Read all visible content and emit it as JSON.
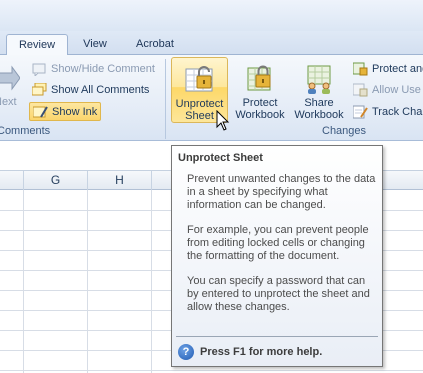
{
  "tabs": [
    {
      "label": "Review",
      "active": true
    },
    {
      "label": "View",
      "active": false
    },
    {
      "label": "Acrobat",
      "active": false
    }
  ],
  "comments_group": {
    "partial_left_label": "Next",
    "show_hide_comment": "Show/Hide Comment",
    "show_all_comments": "Show All Comments",
    "show_ink": "Show Ink",
    "group_label": "Comments"
  },
  "changes_group": {
    "unprotect_sheet": "Unprotect Sheet",
    "unprotect_sheet_line1": "Unprotect",
    "unprotect_sheet_line2": "Sheet",
    "protect_workbook_line1": "Protect",
    "protect_workbook_line2": "Workbook",
    "share_workbook_line1": "Share",
    "share_workbook_line2": "Workbook",
    "protect_and_share": "Protect and",
    "allow_users": "Allow Use",
    "track_changes": "Track Char",
    "group_label": "Changes"
  },
  "sheet": {
    "columns": [
      "G",
      "H"
    ]
  },
  "tooltip": {
    "title": "Unprotect Sheet",
    "paragraphs": [
      "Prevent unwanted changes to the data in a sheet by specifying what information can be changed.",
      "For example, you can prevent people from editing locked cells or changing the formatting of the document.",
      "You can specify a password that can by entered to unprotect the sheet and allow these changes."
    ],
    "help_text": "Press F1 for more help."
  },
  "colors": {
    "ribbon_bg": "#e3ebf6",
    "hover_highlight": "#fdd868",
    "pressed_highlight": "#fbd56c",
    "text": "#1e395b"
  }
}
